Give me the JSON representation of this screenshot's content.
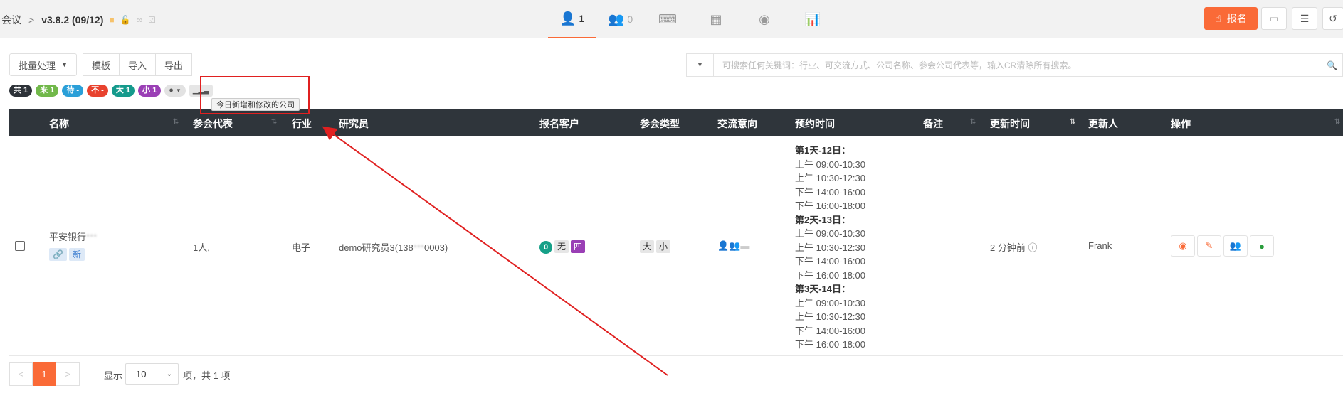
{
  "breadcrumb": {
    "root": "会议",
    "separator": ">",
    "version": "v3.8.2 (09/12)"
  },
  "tabs": [
    {
      "name": "tab-person",
      "icon": "person-icon",
      "glyph": "👤",
      "count": "1",
      "active": true
    },
    {
      "name": "tab-group",
      "icon": "group-icon",
      "glyph": "👥",
      "count": "0",
      "active": false
    },
    {
      "name": "tab-keyboard",
      "icon": "keyboard-icon",
      "glyph": "⌨",
      "count": "",
      "active": false
    },
    {
      "name": "tab-calculator",
      "icon": "calculator-icon",
      "glyph": "▦",
      "count": "",
      "active": false
    },
    {
      "name": "tab-webcam",
      "icon": "webcam-icon",
      "glyph": "◉",
      "count": "",
      "active": false
    },
    {
      "name": "tab-chart",
      "icon": "chart-icon",
      "glyph": "📊",
      "count": "",
      "active": false
    }
  ],
  "header": {
    "signup_label": "报名",
    "accent": "#fa6a37"
  },
  "toolbar": {
    "batch_label": "批量处理",
    "template_label": "模板",
    "import_label": "导入",
    "export_label": "导出"
  },
  "search": {
    "placeholder": "可搜索任何关键词：行业、可交流方式、公司名称、参会公司代表等，输入CR清除所有搜索。"
  },
  "filters": [
    {
      "label": "共 1",
      "cls": "b-dark"
    },
    {
      "label": "来 1",
      "cls": "b-green"
    },
    {
      "label": "待 -",
      "cls": "b-blue"
    },
    {
      "label": "不 -",
      "cls": "b-red"
    },
    {
      "label": "大 1",
      "cls": "b-teal"
    },
    {
      "label": "小 1",
      "cls": "b-purple"
    }
  ],
  "tooltip": "今日新增和修改的公司",
  "columns": {
    "name": "名称",
    "rep": "参会代表",
    "industry": "行业",
    "researcher": "研究员",
    "clients": "报名客户",
    "mtype": "参会类型",
    "intent": "交流意向",
    "time": "预约时间",
    "remark": "备注",
    "updated": "更新时间",
    "updater": "更新人",
    "ops": "操作"
  },
  "row": {
    "company": "平安银行",
    "company_blur": "***",
    "tag_new": "新",
    "rep": "1人,",
    "industry": "电子",
    "researcher": "demo研究员3(138",
    "researcher_tail": "0003)",
    "clients_count": "0",
    "clients_none": "无",
    "clients_four": "四",
    "type_big": "大",
    "type_small": "小",
    "updated": "2 分钟前",
    "updater": "Frank"
  },
  "schedule": [
    {
      "day": "第1天-12日：",
      "slots": [
        "上午 09:00-10:30",
        "上午 10:30-12:30",
        "下午 14:00-16:00",
        "下午 16:00-18:00"
      ]
    },
    {
      "day": "第2天-13日：",
      "slots": [
        "上午 09:00-10:30",
        "上午 10:30-12:30",
        "下午 14:00-16:00",
        "下午 16:00-18:00"
      ]
    },
    {
      "day": "第3天-14日：",
      "slots": [
        "上午 09:00-10:30",
        "上午 10:30-12:30",
        "下午 14:00-16:00",
        "下午 16:00-18:00"
      ]
    }
  ],
  "pagination": {
    "prev": "<",
    "current": "1",
    "next": ">",
    "show_label": "显示",
    "page_size": "10",
    "total_text": "项，共 1 项"
  },
  "colors": {
    "action_orange": "#fa6a37",
    "action_green": "#2a9d3c",
    "annotation_red": "#e02020"
  }
}
